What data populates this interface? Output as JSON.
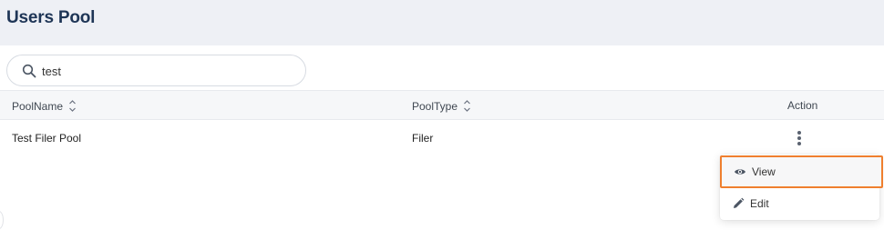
{
  "header": {
    "title": "Users Pool"
  },
  "search": {
    "value": "test",
    "icon": "search-icon"
  },
  "table": {
    "columns": [
      {
        "label": "PoolName",
        "sortable": true
      },
      {
        "label": "PoolType",
        "sortable": true
      },
      {
        "label": "Action",
        "sortable": false
      }
    ],
    "rows": [
      {
        "pool_name": "Test Filer Pool",
        "pool_type": "Filer"
      }
    ]
  },
  "action_menu": {
    "items": [
      {
        "label": "View",
        "icon": "eye-icon",
        "highlighted": true
      },
      {
        "label": "Edit",
        "icon": "pencil-icon"
      }
    ]
  },
  "colors": {
    "title": "#1e3556",
    "header_bg": "#eef0f5",
    "highlight_border": "#ef7f2e"
  }
}
